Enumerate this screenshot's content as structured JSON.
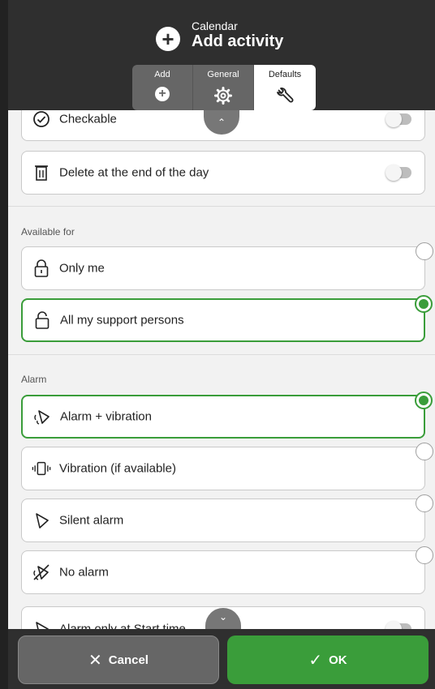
{
  "header": {
    "subtitle": "Calendar",
    "title": "Add activity",
    "tabs": [
      {
        "label": "Add",
        "icon": "plus-circle-icon"
      },
      {
        "label": "General",
        "icon": "gear-icon"
      },
      {
        "label": "Defaults",
        "icon": "wrench-icon",
        "active": true
      }
    ]
  },
  "settings": [
    {
      "label": "Checkable",
      "icon": "check-circle-icon",
      "toggle": false
    },
    {
      "label": "Delete at the end of the day",
      "icon": "trash-icon",
      "toggle": false
    }
  ],
  "available_for": {
    "section_label": "Available for",
    "options": [
      {
        "label": "Only me",
        "icon": "lock-closed-icon",
        "selected": false
      },
      {
        "label": "All my support persons",
        "icon": "lock-open-icon",
        "selected": true
      }
    ]
  },
  "alarm": {
    "section_label": "Alarm",
    "options": [
      {
        "label": "Alarm + vibration",
        "icon": "bell-vibrate-icon",
        "selected": true
      },
      {
        "label": "Vibration (if available)",
        "icon": "vibration-icon",
        "selected": false
      },
      {
        "label": "Silent alarm",
        "icon": "bell-icon",
        "selected": false
      },
      {
        "label": "No alarm",
        "icon": "bell-off-icon",
        "selected": false
      }
    ],
    "partial_row": {
      "label": "Alarm only at Start time",
      "toggle": false
    }
  },
  "scroll": {
    "up_glyph": "⌃",
    "down_glyph": "⌄"
  },
  "footer": {
    "cancel_label": "Cancel",
    "cancel_glyph": "✕",
    "ok_label": "OK",
    "ok_glyph": "✓"
  },
  "colors": {
    "accent": "#3a9d3a",
    "header_bg": "#2f2f2f",
    "content_bg": "#f2f2f2"
  }
}
